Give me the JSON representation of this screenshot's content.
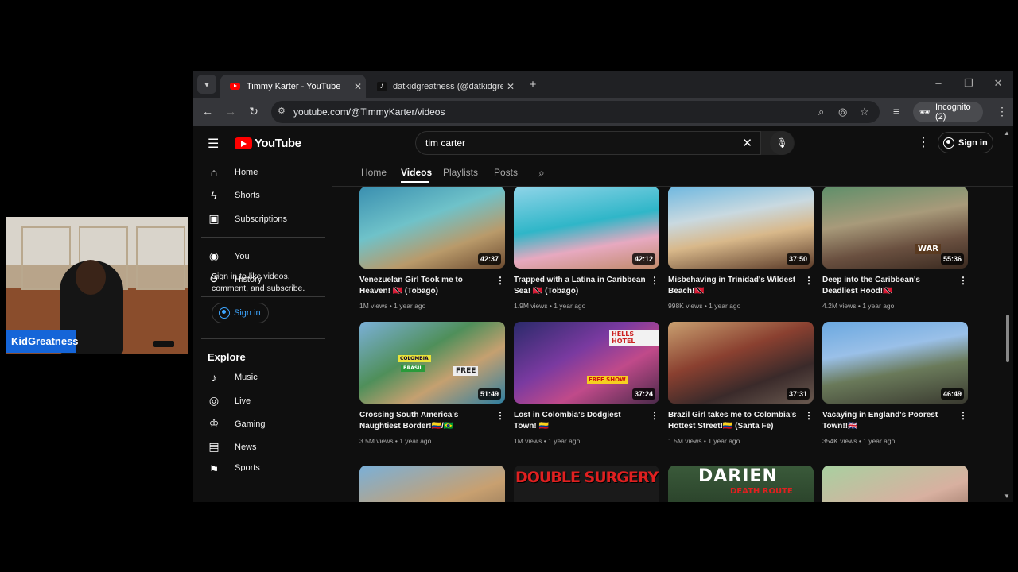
{
  "webcam": {
    "name": "KidGreatness"
  },
  "browser": {
    "tabs": [
      {
        "title": "Timmy Karter - YouTube",
        "active": true
      },
      {
        "title": "datkidgreatness (@datkidgreat",
        "active": false
      }
    ],
    "url": "youtube.com/@TimmyKarter/videos",
    "incognito_label": "Incognito (2)"
  },
  "youtube": {
    "logo_text": "YouTube",
    "search_value": "tim carter",
    "signin_label": "Sign in",
    "sidebar": {
      "items_top": [
        {
          "label": "Home",
          "icon": "home-icon"
        },
        {
          "label": "Shorts",
          "icon": "shorts-icon"
        },
        {
          "label": "Subscriptions",
          "icon": "subscriptions-icon"
        }
      ],
      "items_you": [
        {
          "label": "You",
          "icon": "you-icon"
        },
        {
          "label": "History",
          "icon": "history-icon"
        }
      ],
      "signin_note": "Sign in to like videos, comment, and subscribe.",
      "signin_button": "Sign in",
      "explore_heading": "Explore",
      "explore_items": [
        {
          "label": "Music",
          "icon": "music-icon"
        },
        {
          "label": "Live",
          "icon": "live-icon"
        },
        {
          "label": "Gaming",
          "icon": "gaming-icon"
        },
        {
          "label": "News",
          "icon": "news-icon"
        },
        {
          "label": "Sports",
          "icon": "sports-icon"
        }
      ]
    },
    "channel_tabs": [
      "Home",
      "Videos",
      "Playlists",
      "Posts"
    ],
    "active_tab": "Videos",
    "videos": [
      {
        "title": "Venezuelan Girl Took me to Heaven! 🇹🇹 (Tobago)",
        "views": "1M views",
        "age": "1 year ago",
        "duration": "42:37"
      },
      {
        "title": "Trapped with a Latina in Caribbean Sea! 🇹🇹 (Tobago)",
        "views": "1.9M views",
        "age": "1 year ago",
        "duration": "42:12"
      },
      {
        "title": "Misbehaving in Trinidad's Wildest Beach!🇹🇹",
        "views": "998K views",
        "age": "1 year ago",
        "duration": "37:50"
      },
      {
        "title": "Deep into the Caribbean's Deadliest Hood!🇹🇹",
        "views": "4.2M views",
        "age": "1 year ago",
        "duration": "55:36"
      },
      {
        "title": "Crossing South America's Naughtiest Border!🇨🇴/🇧🇷",
        "views": "3.5M views",
        "age": "1 year ago",
        "duration": "51:49"
      },
      {
        "title": "Lost in Colombia's Dodgiest Town! 🇨🇴",
        "views": "1M views",
        "age": "1 year ago",
        "duration": "37:24"
      },
      {
        "title": "Brazil Girl takes me to Colombia's Hottest Street!🇨🇴 (Santa Fe)",
        "views": "1.5M views",
        "age": "1 year ago",
        "duration": "37:31"
      },
      {
        "title": "Vacaying in England's Poorest Town!!🇬🇧",
        "views": "354K views",
        "age": "1 year ago",
        "duration": "46:49"
      }
    ],
    "thumb_texts": {
      "v4": "WAR",
      "v5a": "COLOMBIA",
      "v5b": "BRASIL",
      "v5c": "FREE",
      "v6a": "FREE SHOW",
      "v6b": "HELLS HOTEL",
      "r3b": "DOUBLE SURGERY",
      "r3c": "DARIEN",
      "r3c2": "DEATH ROUTE"
    }
  }
}
